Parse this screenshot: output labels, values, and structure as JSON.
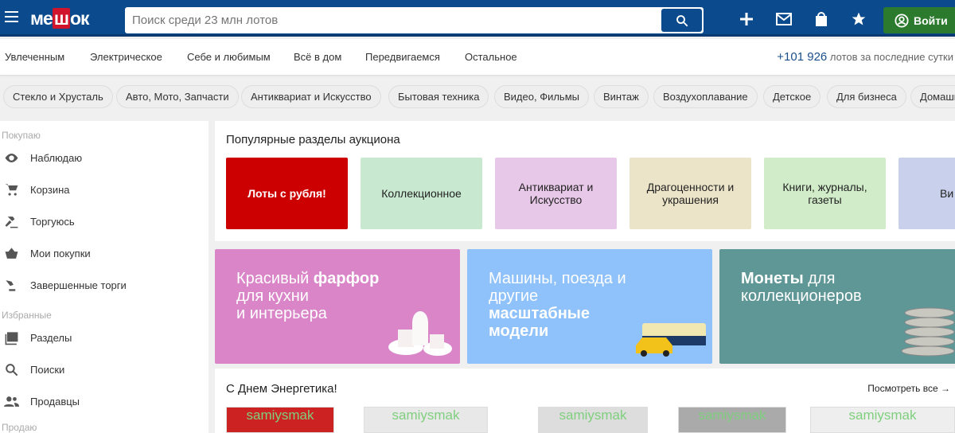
{
  "header": {
    "logo": "мешок",
    "search_placeholder": "Поиск среди 23 млн лотов",
    "login_label": "Войти"
  },
  "nav": {
    "items": [
      "Увлеченным",
      "Электрическое",
      "Себе и любимым",
      "Всё в дом",
      "Передвигаемся",
      "Остальное"
    ],
    "lots_count": "+101 926",
    "lots_text": " лотов за последние сутки"
  },
  "chips": [
    "Стекло и Хрусталь",
    "Авто, Мото, Запчасти",
    "Антиквариат и Искусство",
    "Бытовая техника",
    "Видео, Фильмы",
    "Винтаж",
    "Воздухоплавание",
    "Детское",
    "Для бизнеса",
    "Домашн"
  ],
  "sidebar": {
    "buy_heading": "Покупаю",
    "buy_items": [
      "Наблюдаю",
      "Корзина",
      "Торгуюсь",
      "Мои покупки",
      "Завершенные торги"
    ],
    "fav_heading": "Избранные",
    "fav_items": [
      "Разделы",
      "Поиски",
      "Продавцы"
    ],
    "sell_heading": "Продаю"
  },
  "popular": {
    "title": "Популярные разделы аукциона",
    "tiles": [
      {
        "label": "Лоты с рубля!",
        "color": "#cc0000"
      },
      {
        "label": "Коллекционное",
        "color": "#c8e8d0"
      },
      {
        "label": "Антиквариат и Искусство",
        "color": "#e8c8e8"
      },
      {
        "label": "Драгоценности и украшения",
        "color": "#ece4c8"
      },
      {
        "label": "Книги, журналы, газеты",
        "color": "#d0ecc8"
      },
      {
        "label": "Ви",
        "color": "#c8d0ec"
      }
    ]
  },
  "banners": [
    {
      "pre": "Красивый ",
      "bold": "фарфор",
      "post": "для кухни",
      "post2": "и интерьера",
      "color": "#d985c8"
    },
    {
      "pre": "Машины, поезда и",
      "post": "другие",
      "bold": "масштабные",
      "bold2": "модели",
      "color": "#8fc1fa"
    },
    {
      "bold": "Монеты",
      "pre": " для",
      "post": "коллекционеров",
      "color": "#5f9796"
    }
  ],
  "energy": {
    "title": "С Днем Энергетика!",
    "view_all": "Посмотреть все →",
    "watermark": "samiysmak"
  }
}
